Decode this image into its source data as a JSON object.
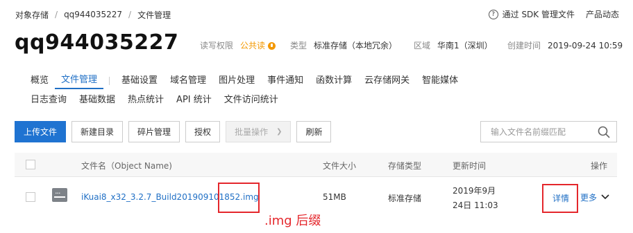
{
  "breadcrumb": [
    "对象存储",
    "qq944035227",
    "文件管理"
  ],
  "top_links": {
    "sdk": "通过 SDK 管理文件",
    "news": "产品动态"
  },
  "bucket": {
    "name": "qq944035227",
    "perm_label": "读写权限",
    "perm_value": "公共读",
    "type_label": "类型",
    "type_value": "标准存储（本地冗余）",
    "region_label": "区域",
    "region_value": "华南1（深圳）",
    "created_label": "创建时间",
    "created_value": "2019-09-24 10:59"
  },
  "tabs_row1": [
    "概览",
    "文件管理",
    "基础设置",
    "域名管理",
    "图片处理",
    "事件通知",
    "函数计算",
    "云存储网关",
    "智能媒体"
  ],
  "tabs_row2": [
    "日志查询",
    "基础数据",
    "热点统计",
    "API 统计",
    "文件访问统计"
  ],
  "active_tab": "文件管理",
  "toolbar": {
    "upload": "上传文件",
    "new_dir": "新建目录",
    "fragments": "碎片管理",
    "auth": "授权",
    "batch": "批量操作",
    "refresh": "刷新"
  },
  "search": {
    "placeholder": "输入文件名前缀匹配"
  },
  "table": {
    "headers": {
      "name": "文件名（Object Name)",
      "size": "文件大小",
      "storage": "存储类型",
      "updated": "更新时间",
      "actions": "操作"
    },
    "rows": [
      {
        "name": "iKuai8_x32_3.2.7_Build201909101852.img",
        "size": "51MB",
        "storage": "标准存储",
        "updated_date": "2019年9月",
        "updated_time": "24日 11:03",
        "detail": "详情",
        "more": "更多"
      }
    ]
  },
  "annotation": ".img 后缀",
  "colors": {
    "accent": "#1f73d1",
    "link": "#1f6fc5",
    "warning": "#f39800",
    "highlight": "#e4262b"
  },
  "icons": {
    "help": "help-circle-icon",
    "perm": "lock-icon",
    "search": "search-icon",
    "file": "file-icon",
    "caret": "chevron-down-icon"
  }
}
